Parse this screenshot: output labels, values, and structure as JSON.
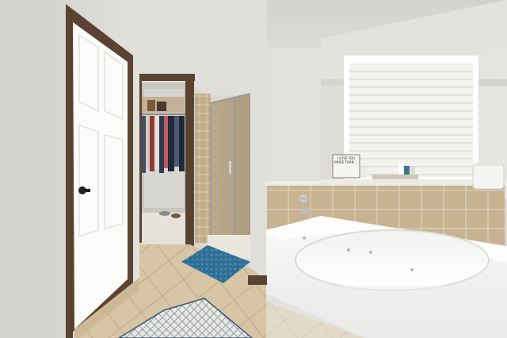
{
  "photo": {
    "room": "bathroom",
    "colors": {
      "wall": "#dcdad5",
      "ceiling": "#e3e1dc",
      "door": "#fbfbf9",
      "door_frame": "#5a4330",
      "floor_tile": "#d7c4a4",
      "tub": "#f7f7f6",
      "tub_tile": "#c3ad8c",
      "bath_mat": "#2f6f96",
      "window_blinds": "#f3f2ee",
      "closet_clothes": "#2c3a4f"
    },
    "sign": {
      "text": "I LOVE YOU MORE THAN ..."
    }
  }
}
